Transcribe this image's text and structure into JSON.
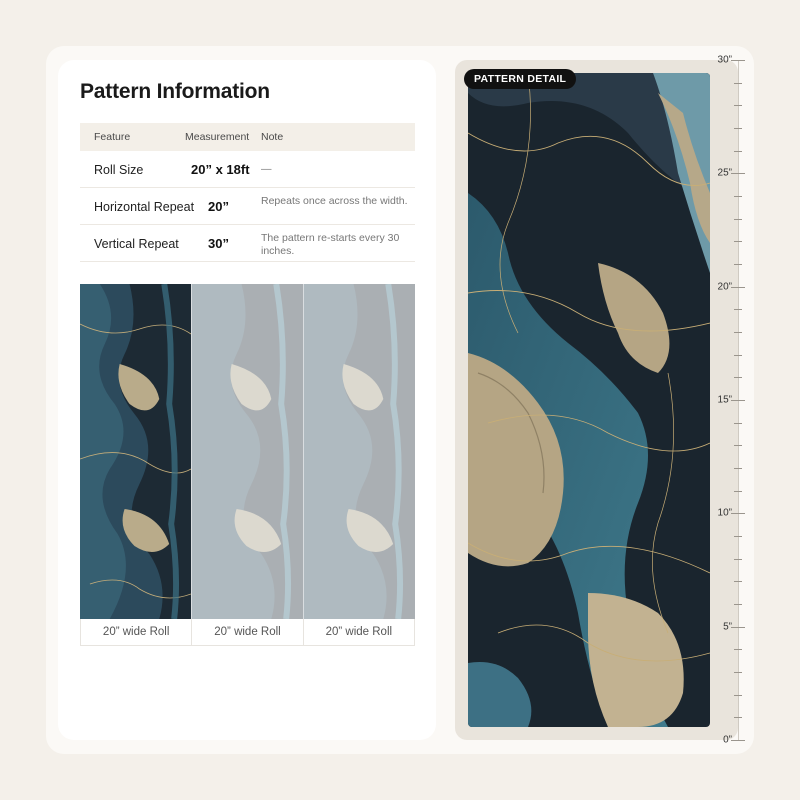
{
  "title": "Pattern Information",
  "table": {
    "headers": [
      "Feature",
      "Measurement",
      "Note"
    ],
    "rows": [
      {
        "feature": "Roll Size",
        "measurement": "20” x 18ft",
        "note": "—"
      },
      {
        "feature": "Horizontal Repeat",
        "measurement": "20”",
        "note": "Repeats once across the width."
      },
      {
        "feature": "Vertical Repeat",
        "measurement": "30”",
        "note": "The pattern re-starts every 30 inches."
      }
    ]
  },
  "rolls": {
    "labels": [
      "20” wide Roll",
      "20” wide Roll",
      "20” wide Roll"
    ]
  },
  "detail": {
    "badge": "PATTERN DETAIL"
  },
  "ruler": {
    "labels": [
      "30”",
      "25”",
      "20”",
      "15”",
      "10”",
      "5”",
      "0”"
    ]
  },
  "colors": {
    "dark": "#1b2630",
    "teal": "#2f5f73",
    "gold": "#b8a886",
    "background": "#f4f0ea"
  }
}
